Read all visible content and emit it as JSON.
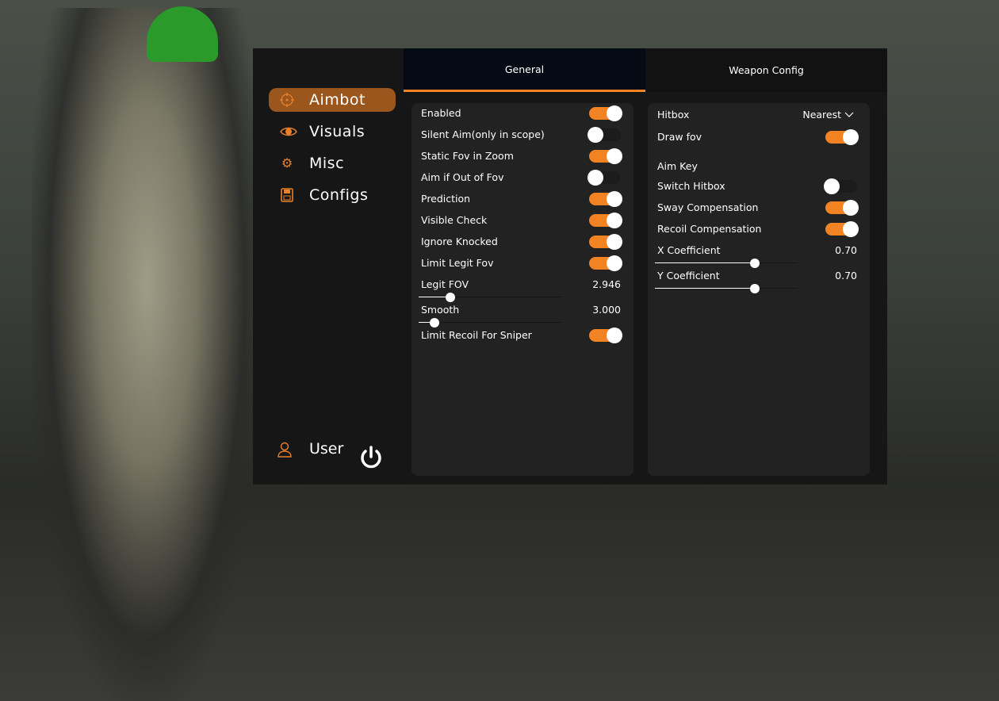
{
  "accent": "#f28322",
  "sidebar": {
    "items": [
      {
        "label": "Aimbot",
        "icon": "crosshair-icon",
        "active": true
      },
      {
        "label": "Visuals",
        "icon": "eye-icon",
        "active": false
      },
      {
        "label": "Misc",
        "icon": "gears-icon",
        "active": false
      },
      {
        "label": "Configs",
        "icon": "floppy-disk-icon",
        "active": false
      }
    ],
    "user_label": "User",
    "user_icon": "user-icon",
    "power_icon": "power-icon"
  },
  "tabs": [
    {
      "label": "General",
      "active": true
    },
    {
      "label": "Weapon Config",
      "active": false
    }
  ],
  "general": {
    "toggles": [
      {
        "label": "Enabled",
        "on": true
      },
      {
        "label": "Silent Aim(only in scope)",
        "on": false
      },
      {
        "label": "Static Fov in Zoom",
        "on": true
      },
      {
        "label": "Aim if Out of Fov",
        "on": false
      },
      {
        "label": "Prediction",
        "on": true
      },
      {
        "label": "Visible Check",
        "on": true
      },
      {
        "label": "Ignore Knocked",
        "on": true
      },
      {
        "label": "Limit Legit Fov",
        "on": true
      }
    ],
    "sliders": [
      {
        "label": "Legit FOV",
        "value": "2.946",
        "fraction": 0.22
      },
      {
        "label": "Smooth",
        "value": "3.000",
        "fraction": 0.11
      }
    ],
    "last_toggle": {
      "label": "Limit Recoil For Sniper",
      "on": true
    }
  },
  "weapon": {
    "hitbox": {
      "label": "Hitbox",
      "value": "Nearest"
    },
    "draw_fov": {
      "label": "Draw fov",
      "on": true
    },
    "aim_key": {
      "label": "Aim Key"
    },
    "toggles": [
      {
        "label": "Switch Hitbox",
        "on": false
      },
      {
        "label": "Sway Compensation",
        "on": true
      },
      {
        "label": "Recoil Compensation",
        "on": true
      }
    ],
    "sliders": [
      {
        "label": "X Coefficient",
        "value": "0.70",
        "fraction": 0.7
      },
      {
        "label": "Y Coefficient",
        "value": "0.70",
        "fraction": 0.7
      }
    ]
  }
}
